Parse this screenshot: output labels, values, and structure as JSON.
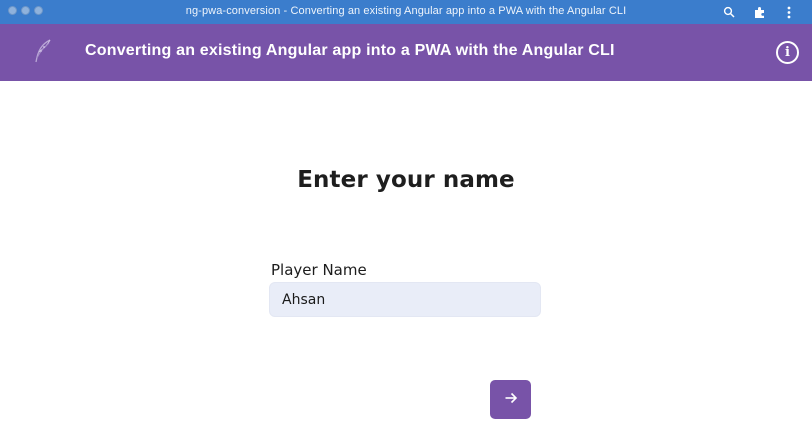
{
  "window": {
    "title": "ng-pwa-conversion - Converting an existing Angular app into a PWA with the Angular CLI",
    "actions": [
      "search-icon",
      "extensions-icon",
      "more-icon"
    ]
  },
  "header": {
    "logo": "feather-logo",
    "title": "Converting an existing Angular app into a PWA with the Angular CLI",
    "info_icon": "info-icon",
    "info_glyph": "i"
  },
  "main": {
    "heading": "Enter your name",
    "player_name_label": "Player Name",
    "player_name_value": "Ahsan",
    "submit_icon": "arrow-right-icon"
  },
  "colors": {
    "titlebar": "#3b7dcc",
    "accent": "#7853a8",
    "input_bg": "#e9edf8"
  }
}
